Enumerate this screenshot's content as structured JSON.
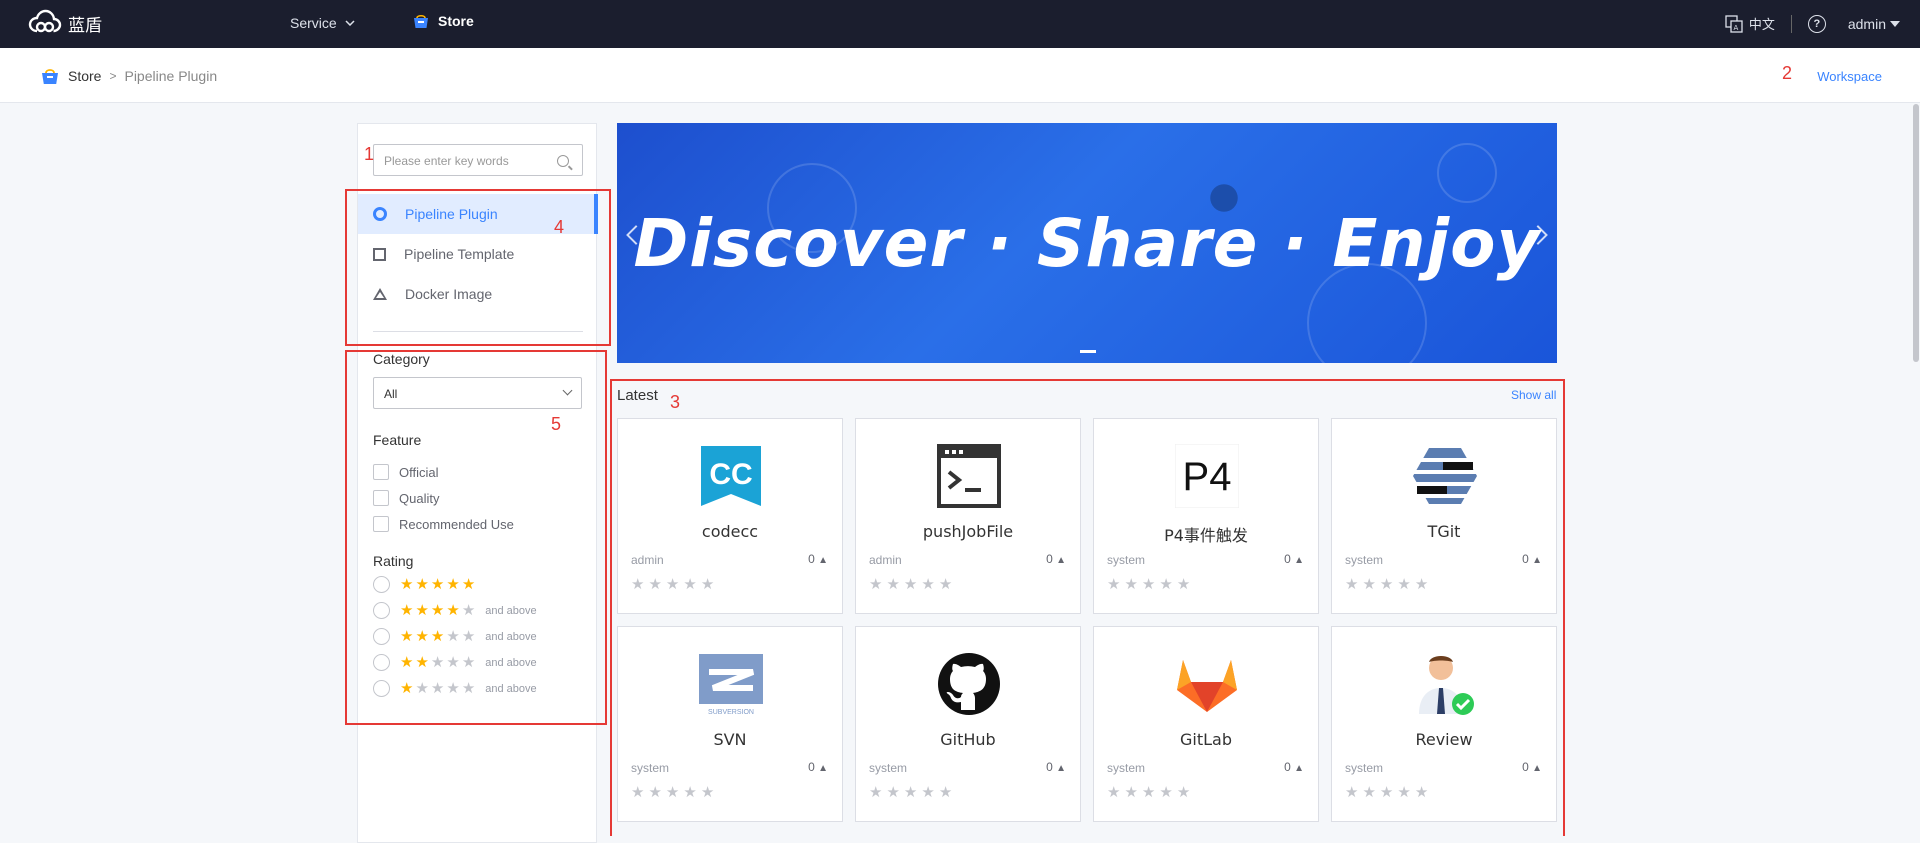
{
  "header": {
    "brand": "蓝盾",
    "nav_service": "Service",
    "nav_store": "Store",
    "lang": "中文",
    "help": "?",
    "user": "admin"
  },
  "breadcrumb": {
    "store": "Store",
    "current": "Pipeline Plugin",
    "workspace": "Workspace"
  },
  "annotations": [
    "1",
    "2",
    "3",
    "4",
    "5"
  ],
  "sidebar": {
    "search_placeholder": "Please enter key words",
    "types": [
      {
        "label": "Pipeline Plugin",
        "active": true
      },
      {
        "label": "Pipeline Template",
        "active": false
      },
      {
        "label": "Docker Image",
        "active": false
      }
    ],
    "category_label": "Category",
    "category_value": "All",
    "feature_label": "Feature",
    "features": [
      "Official",
      "Quality",
      "Recommended Use"
    ],
    "rating_label": "Rating",
    "ratings": [
      {
        "stars": 5,
        "suffix": ""
      },
      {
        "stars": 4,
        "suffix": "and above"
      },
      {
        "stars": 3,
        "suffix": "and above"
      },
      {
        "stars": 2,
        "suffix": "and above"
      },
      {
        "stars": 1,
        "suffix": "and above"
      }
    ]
  },
  "banner": {
    "title": "Discover · Share · Enjoy"
  },
  "latest": {
    "title": "Latest",
    "show_all": "Show all",
    "cards": [
      {
        "name": "codecc",
        "owner": "admin",
        "count": "0",
        "icon": "codecc-icon"
      },
      {
        "name": "pushJobFile",
        "owner": "admin",
        "count": "0",
        "icon": "terminal-icon"
      },
      {
        "name": "P4事件触发",
        "owner": "system",
        "count": "0",
        "icon": "p4-icon"
      },
      {
        "name": "TGit",
        "owner": "system",
        "count": "0",
        "icon": "tgit-icon"
      },
      {
        "name": "SVN",
        "owner": "system",
        "count": "0",
        "icon": "svn-icon"
      },
      {
        "name": "GitHub",
        "owner": "system",
        "count": "0",
        "icon": "github-icon"
      },
      {
        "name": "GitLab",
        "owner": "system",
        "count": "0",
        "icon": "gitlab-icon"
      },
      {
        "name": "Review",
        "owner": "system",
        "count": "0",
        "icon": "review-icon"
      }
    ]
  },
  "colors": {
    "accent": "#3a84ff",
    "topbar": "#1b1e2e",
    "annotation": "#e53935",
    "star": "#ffb400"
  }
}
